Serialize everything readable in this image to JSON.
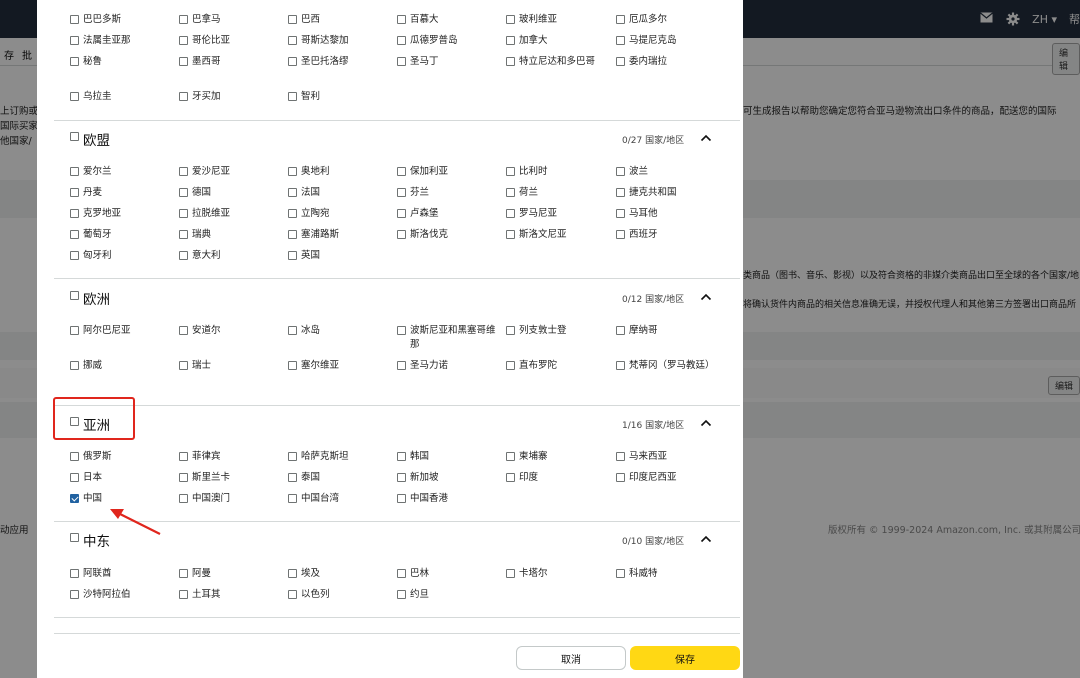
{
  "background": {
    "top_bar": {
      "language": "ZH",
      "help_text": "帮"
    },
    "sub_bar_left": [
      "存",
      "批"
    ],
    "edit_button_top": "编辑",
    "edit_button_mid": "编辑",
    "left_text": [
      "上订购或",
      "国际买家",
      "他国家/"
    ],
    "right_text": [
      "可生成报告以帮助您确定您符合亚马逊物流出口条件的商品，配送您的国际",
      "类商品（图书、音乐、影视）以及符合资格的非媒介类商品出口至全球的各个国家/地",
      "将确认货件内商品的相关信息准确无误，并授权代理人和其他第三方签署出口商品所"
    ],
    "footer_left": "动应用",
    "copyright": "版权所有 © 1999-2024 Amazon.com, Inc. 或其附属公司"
  },
  "modal": {
    "regions": [
      {
        "name": "",
        "count": "",
        "countries": [
          [
            "巴巴多斯",
            "巴拿马",
            "巴西",
            "百慕大",
            "玻利维亚",
            "厄瓜多尔"
          ],
          [
            "法属圭亚那",
            "哥伦比亚",
            "哥斯达黎加",
            "瓜德罗普岛",
            "加拿大",
            "马提尼克岛"
          ],
          [
            "秘鲁",
            "墨西哥",
            "圣巴托洛缪",
            "圣马丁",
            "特立尼达和多巴哥",
            "委内瑞拉"
          ],
          [
            "乌拉圭",
            "牙买加",
            "智利"
          ]
        ]
      },
      {
        "name": "欧盟",
        "count": "0/27 国家/地区",
        "countries": [
          [
            "爱尔兰",
            "爱沙尼亚",
            "奥地利",
            "保加利亚",
            "比利时",
            "波兰"
          ],
          [
            "丹麦",
            "德国",
            "法国",
            "芬兰",
            "荷兰",
            "捷克共和国"
          ],
          [
            "克罗地亚",
            "拉脱维亚",
            "立陶宛",
            "卢森堡",
            "罗马尼亚",
            "马耳他"
          ],
          [
            "葡萄牙",
            "瑞典",
            "塞浦路斯",
            "斯洛伐克",
            "斯洛文尼亚",
            "西班牙"
          ],
          [
            "匈牙利",
            "意大利",
            "英国"
          ]
        ]
      },
      {
        "name": "欧洲",
        "count": "0/12 国家/地区",
        "countries": [
          [
            "阿尔巴尼亚",
            "安道尔",
            "冰岛",
            "波斯尼亚和黑塞哥维那",
            "列支敦士登",
            "摩纳哥"
          ],
          [
            "挪威",
            "瑞士",
            "塞尔维亚",
            "圣马力诺",
            "直布罗陀",
            "梵蒂冈（罗马教廷）"
          ]
        ]
      },
      {
        "name": "亚洲",
        "count": "1/16 国家/地区",
        "countries": [
          [
            "俄罗斯",
            "菲律宾",
            "哈萨克斯坦",
            "韩国",
            "柬埔寨",
            "马来西亚"
          ],
          [
            "日本",
            "斯里兰卡",
            "泰国",
            "新加坡",
            "印度",
            "印度尼西亚"
          ],
          [
            "中国",
            "中国澳门",
            "中国台湾",
            "中国香港"
          ]
        ],
        "checked": [
          "中国"
        ]
      },
      {
        "name": "中东",
        "count": "0/10 国家/地区",
        "countries": [
          [
            "阿联酋",
            "阿曼",
            "埃及",
            "巴林",
            "卡塔尔",
            "科威特"
          ],
          [
            "沙特阿拉伯",
            "土耳其",
            "以色列",
            "约旦"
          ]
        ]
      }
    ],
    "cancel_label": "取消",
    "save_label": "保存"
  },
  "colors": {
    "top_bar": "#232f3e",
    "save_button": "#ffd814",
    "checkbox_checked": "#2162a1",
    "annotation": "#e0261d"
  }
}
